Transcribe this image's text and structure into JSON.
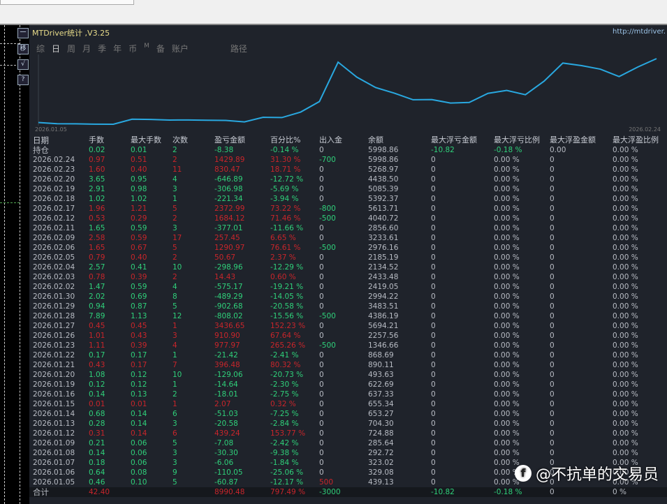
{
  "window": {
    "title": "MTDriver统计 ,V3.25",
    "url": "http://mtdriver."
  },
  "side_buttons": [
    "一",
    "移",
    "√",
    "?"
  ],
  "tabs": [
    {
      "label": "综"
    },
    {
      "label": "日",
      "active": true
    },
    {
      "label": "周"
    },
    {
      "label": "月"
    },
    {
      "label": "季"
    },
    {
      "label": "年"
    },
    {
      "label": "币"
    },
    {
      "label": "M"
    },
    {
      "label": "备"
    },
    {
      "label": "账户"
    },
    {
      "label": "路径"
    }
  ],
  "chart_data": {
    "type": "line",
    "x_start_label": "2026.01.05",
    "x_end_label": "2026.02.24",
    "series_name": "余额",
    "color": "#29a8e0"
  },
  "table": {
    "headers": [
      "日期",
      "手数",
      "最大手数",
      "次数",
      "盈亏金额",
      "百分比%",
      "出入金",
      "余额",
      "最大浮亏金额",
      "最大浮亏比例",
      "最大浮盈金额",
      "最大浮盈比例"
    ],
    "position_row": [
      "持仓",
      "0.02",
      "0.01",
      "2",
      "-8.38",
      "-0.14 %",
      "0",
      "5998.86",
      "-10.82",
      "-0.18 %",
      "0.00",
      "0.00 %"
    ],
    "rows": [
      [
        "2026.02.24",
        "0.97",
        "0.51",
        "2",
        "1429.89",
        "31.30 %",
        "-700",
        "5998.86"
      ],
      [
        "2026.02.23",
        "1.60",
        "0.40",
        "11",
        "830.47",
        "18.71 %",
        "0",
        "5268.97"
      ],
      [
        "2026.02.20",
        "3.65",
        "0.95",
        "4",
        "-646.89",
        "-12.72 %",
        "0",
        "4438.50"
      ],
      [
        "2026.02.19",
        "2.91",
        "0.98",
        "3",
        "-306.98",
        "-5.69 %",
        "0",
        "5085.39"
      ],
      [
        "2026.02.18",
        "1.02",
        "1.02",
        "1",
        "-221.34",
        "-3.94 %",
        "0",
        "5392.37"
      ],
      [
        "2026.02.17",
        "1.96",
        "1.21",
        "5",
        "2372.99",
        "73.22 %",
        "-800",
        "5613.71"
      ],
      [
        "2026.02.12",
        "0.53",
        "0.29",
        "2",
        "1684.12",
        "71.46 %",
        "-500",
        "4040.72"
      ],
      [
        "2026.02.11",
        "1.65",
        "0.59",
        "3",
        "-377.01",
        "-11.66 %",
        "0",
        "2856.60"
      ],
      [
        "2026.02.09",
        "2.58",
        "0.59",
        "17",
        "257.45",
        "6.65 %",
        "0",
        "3233.61"
      ],
      [
        "2026.02.06",
        "1.65",
        "0.67",
        "5",
        "1290.97",
        "76.61 %",
        "-500",
        "2976.16"
      ],
      [
        "2026.02.05",
        "0.79",
        "0.40",
        "2",
        "50.67",
        "2.37 %",
        "0",
        "2185.19"
      ],
      [
        "2026.02.04",
        "2.57",
        "0.41",
        "10",
        "-298.96",
        "-12.29 %",
        "0",
        "2134.52"
      ],
      [
        "2026.02.03",
        "0.78",
        "0.39",
        "2",
        "14.43",
        "0.60 %",
        "0",
        "2433.48"
      ],
      [
        "2026.02.02",
        "1.47",
        "0.59",
        "4",
        "-575.17",
        "-19.21 %",
        "0",
        "2419.05"
      ],
      [
        "2026.01.30",
        "2.02",
        "0.69",
        "8",
        "-489.29",
        "-14.05 %",
        "0",
        "2994.22"
      ],
      [
        "2026.01.29",
        "0.94",
        "0.87",
        "5",
        "-902.68",
        "-20.58 %",
        "0",
        "3483.51"
      ],
      [
        "2026.01.28",
        "7.89",
        "1.13",
        "12",
        "-808.02",
        "-15.56 %",
        "-500",
        "4386.19"
      ],
      [
        "2026.01.27",
        "0.45",
        "0.45",
        "1",
        "3436.65",
        "152.23 %",
        "0",
        "5694.21"
      ],
      [
        "2026.01.26",
        "1.01",
        "0.43",
        "3",
        "910.90",
        "67.64 %",
        "0",
        "2257.56"
      ],
      [
        "2026.01.23",
        "1.11",
        "0.39",
        "4",
        "977.97",
        "265.26 %",
        "-500",
        "1346.66"
      ],
      [
        "2026.01.22",
        "0.17",
        "0.17",
        "1",
        "-21.42",
        "-2.41 %",
        "0",
        "868.69"
      ],
      [
        "2026.01.21",
        "0.43",
        "0.17",
        "7",
        "396.48",
        "80.32 %",
        "0",
        "890.11"
      ],
      [
        "2026.01.20",
        "1.08",
        "0.12",
        "10",
        "-129.06",
        "-20.73 %",
        "0",
        "493.63"
      ],
      [
        "2026.01.19",
        "0.12",
        "0.12",
        "1",
        "-14.64",
        "-2.30 %",
        "0",
        "622.69"
      ],
      [
        "2026.01.16",
        "0.14",
        "0.13",
        "2",
        "-18.01",
        "-2.75 %",
        "0",
        "637.33"
      ],
      [
        "2026.01.15",
        "0.01",
        "0.01",
        "1",
        "2.07",
        "0.32 %",
        "0",
        "655.34"
      ],
      [
        "2026.01.14",
        "0.68",
        "0.14",
        "6",
        "-51.03",
        "-7.25 %",
        "0",
        "653.27"
      ],
      [
        "2026.01.13",
        "0.28",
        "0.14",
        "3",
        "-20.58",
        "-2.84 %",
        "0",
        "704.30"
      ],
      [
        "2026.01.12",
        "0.31",
        "0.14",
        "6",
        "439.24",
        "153.77 %",
        "0",
        "724.88"
      ],
      [
        "2026.01.09",
        "0.21",
        "0.06",
        "5",
        "-7.08",
        "-2.42 %",
        "0",
        "285.64"
      ],
      [
        "2026.01.08",
        "0.14",
        "0.06",
        "3",
        "-30.30",
        "-9.38 %",
        "0",
        "292.72"
      ],
      [
        "2026.01.07",
        "0.18",
        "0.06",
        "3",
        "-6.06",
        "-1.84 %",
        "0",
        "323.02"
      ],
      [
        "2026.01.06",
        "0.64",
        "0.08",
        "9",
        "-110.05",
        "-25.06 %",
        "0",
        "329.08"
      ],
      [
        "2026.01.05",
        "0.46",
        "0.10",
        "5",
        "-60.87",
        "-12.17 %",
        "500",
        "439.13"
      ]
    ],
    "row_float_cells": [
      "0",
      "0.00 %",
      "0",
      "0.00 %"
    ],
    "total_row": [
      "合计",
      "42.40",
      "",
      "",
      "8990.48",
      "797.49 %",
      "-3000",
      "",
      "-10.82",
      "-0.18 %",
      "0",
      "0 %"
    ]
  },
  "colors": {
    "profit": "#c8252b",
    "loss": "#2fd07a",
    "bg": "#1f232b"
  },
  "watermark": "@不抗单的交易员"
}
